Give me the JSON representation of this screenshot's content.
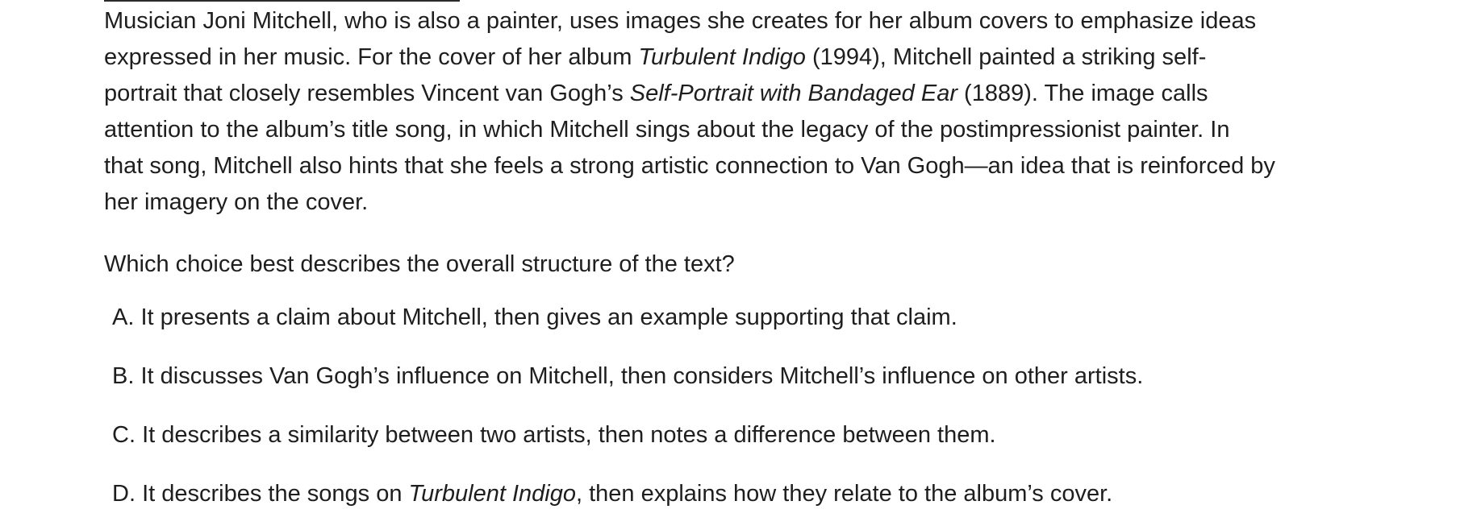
{
  "passage": {
    "lines": [
      [
        "Musician Joni Mitchell, who is also a painter, uses images she creates for her album covers to emphasize ideas"
      ],
      [
        "expressed in her music. For the cover of her album ",
        "Turbulent Indigo",
        " (1994), Mitchell painted a striking self-"
      ],
      [
        "portrait that closely resembles Vincent van Gogh’s ",
        "Self-Portrait with Bandaged Ear",
        " (1889). The image calls"
      ],
      [
        "attention to the album’s title song, in which Mitchell sings about the legacy of the postimpressionist painter. In"
      ],
      [
        "that song, Mitchell also hints that she feels a strong artistic connection to Van Gogh—an idea that is reinforced by"
      ],
      [
        "her imagery on the cover."
      ]
    ]
  },
  "question": "Which choice best describes the overall structure of the text?",
  "choices": [
    {
      "letter": "A.",
      "parts": [
        "It presents a claim about Mitchell, then gives an example supporting that claim."
      ]
    },
    {
      "letter": "B.",
      "parts": [
        "It discusses Van Gogh’s influence on Mitchell, then considers Mitchell’s influence on other artists."
      ]
    },
    {
      "letter": "C.",
      "parts": [
        "It describes a similarity between two artists, then notes a difference between them."
      ]
    },
    {
      "letter": "D.",
      "parts": [
        "It describes the songs on ",
        "Turbulent Indigo",
        ", then explains how they relate to the album’s cover."
      ]
    }
  ]
}
